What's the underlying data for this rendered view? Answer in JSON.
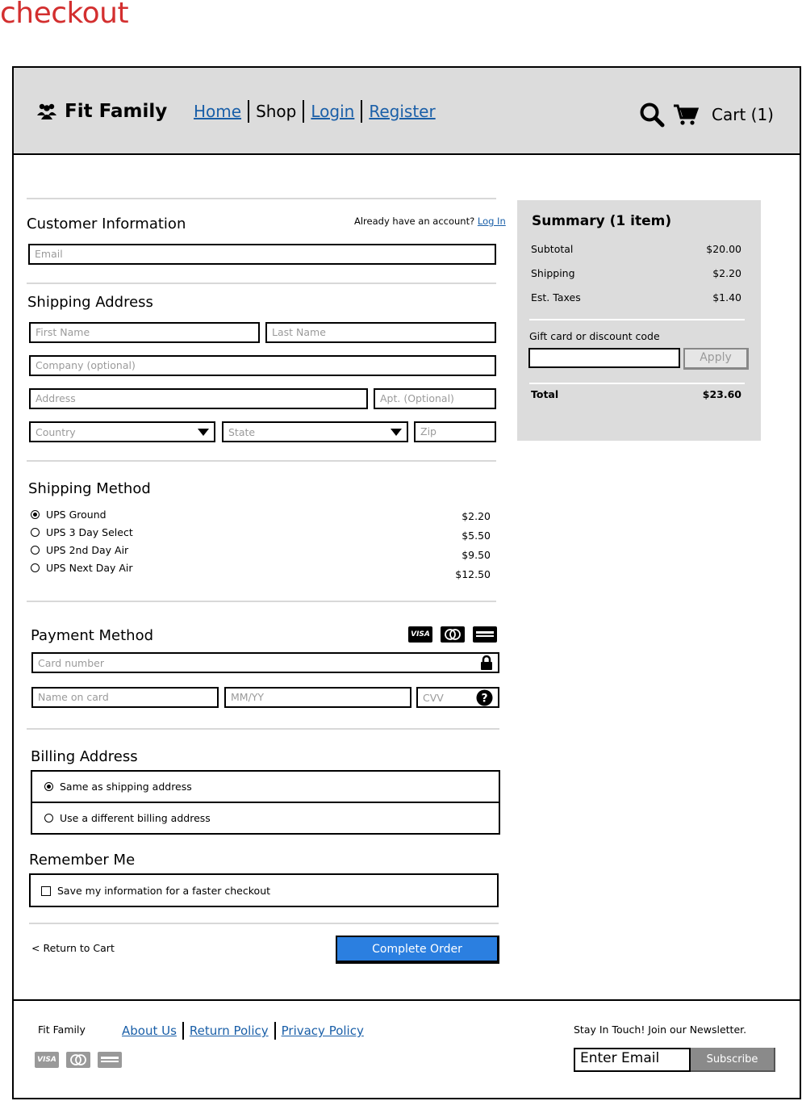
{
  "page_label": "checkout",
  "header": {
    "brand": "Fit Family",
    "nav": {
      "home": "Home",
      "shop": "Shop",
      "login": "Login",
      "register": "Register"
    },
    "cart": "Cart (1)"
  },
  "customer": {
    "title": "Customer Information",
    "have_account": "Already have an account?",
    "login_link": "Log In",
    "email_placeholder": "Email"
  },
  "shipping_address": {
    "title": "Shipping Address",
    "first_name": "First Name",
    "last_name": "Last Name",
    "company": "Company (optional)",
    "address": "Address",
    "apt": "Apt. (Optional)",
    "country": "Country",
    "state": "State",
    "zip": "Zip"
  },
  "shipping_method": {
    "title": "Shipping Method",
    "options": [
      {
        "label": "UPS Ground",
        "price": "$2.20",
        "selected": true
      },
      {
        "label": "UPS 3 Day Select",
        "price": "$5.50",
        "selected": false
      },
      {
        "label": "UPS 2nd Day Air",
        "price": "$9.50",
        "selected": false
      },
      {
        "label": "UPS Next Day Air",
        "price": "$12.50",
        "selected": false
      }
    ]
  },
  "payment": {
    "title": "Payment Method",
    "card_number": "Card number",
    "name_on_card": "Name on card",
    "expiry": "MM/YY",
    "cvv": "CVV",
    "brands": {
      "visa": "VISA"
    }
  },
  "billing": {
    "title": "Billing Address",
    "same": "Same as shipping address",
    "different": "Use a different billing address"
  },
  "remember": {
    "title": "Remember Me",
    "save": "Save my information for a faster checkout"
  },
  "actions": {
    "return": "< Return to Cart",
    "complete": "Complete Order"
  },
  "summary": {
    "title": "Summary (1 item)",
    "subtotal_label": "Subtotal",
    "subtotal": "$20.00",
    "shipping_label": "Shipping",
    "shipping": "$2.20",
    "taxes_label": "Est. Taxes",
    "taxes": "$1.40",
    "gift_label": "Gift card or discount code",
    "apply": "Apply",
    "total_label": "Total",
    "total": "$23.60"
  },
  "footer": {
    "brand": "Fit Family",
    "about": "About Us",
    "return_policy": "Return Policy",
    "privacy": "Privacy Policy",
    "newsletter": "Stay In Touch! Join our Newsletter.",
    "email_placeholder": "Enter Email",
    "subscribe": "Subscribe"
  },
  "colors": {
    "accent": "#2b7fe0",
    "link": "#1a5fa8",
    "label": "#d32f2f",
    "panel": "#dcdcdc"
  }
}
